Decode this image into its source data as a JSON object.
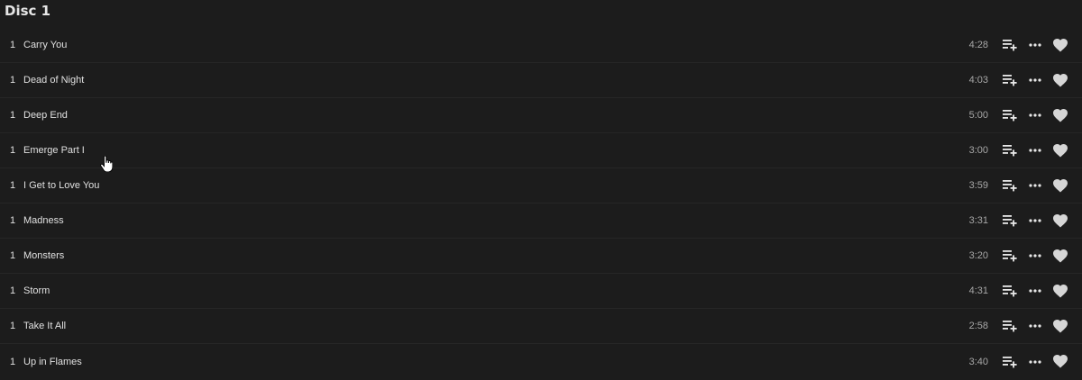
{
  "disc": {
    "title": "Disc 1"
  },
  "tracks": [
    {
      "number": "1",
      "title": "Carry You",
      "duration": "4:28"
    },
    {
      "number": "1",
      "title": "Dead of Night",
      "duration": "4:03"
    },
    {
      "number": "1",
      "title": "Deep End",
      "duration": "5:00"
    },
    {
      "number": "1",
      "title": "Emerge Part I",
      "duration": "3:00"
    },
    {
      "number": "1",
      "title": "I Get to Love You",
      "duration": "3:59"
    },
    {
      "number": "1",
      "title": "Madness",
      "duration": "3:31"
    },
    {
      "number": "1",
      "title": "Monsters",
      "duration": "3:20"
    },
    {
      "number": "1",
      "title": "Storm",
      "duration": "4:31"
    },
    {
      "number": "1",
      "title": "Take It All",
      "duration": "2:58"
    },
    {
      "number": "1",
      "title": "Up in Flames",
      "duration": "3:40"
    }
  ],
  "icons": {
    "queue": "playlist-add-icon",
    "more": "more-horizontal-icon",
    "favorite": "heart-icon",
    "cursor": "hand-pointer-cursor"
  },
  "colors": {
    "background": "#1c1c1c",
    "text": "#e0e0e0",
    "duration": "#a8a8a8",
    "icon": "#e8e8e8",
    "heart": "#d6d6d6",
    "divider": "#262626"
  }
}
